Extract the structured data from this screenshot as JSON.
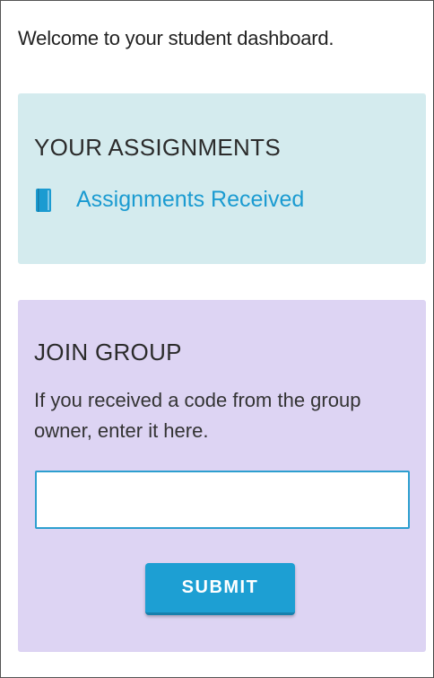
{
  "welcome_text": "Welcome to your student dashboard.",
  "assignments_card": {
    "title": "YOUR ASSIGNMENTS",
    "link_label": "Assignments Received",
    "link_icon": "book-icon",
    "background_color": "#d4ebee",
    "link_color": "#1b9bd1"
  },
  "join_card": {
    "title": "JOIN GROUP",
    "description": "If you received a code from the group owner, enter it here.",
    "code_input": {
      "value": "",
      "placeholder": ""
    },
    "submit_label": "SUBMIT",
    "background_color": "#ddd4f3",
    "button_color": "#1d9fd3"
  }
}
